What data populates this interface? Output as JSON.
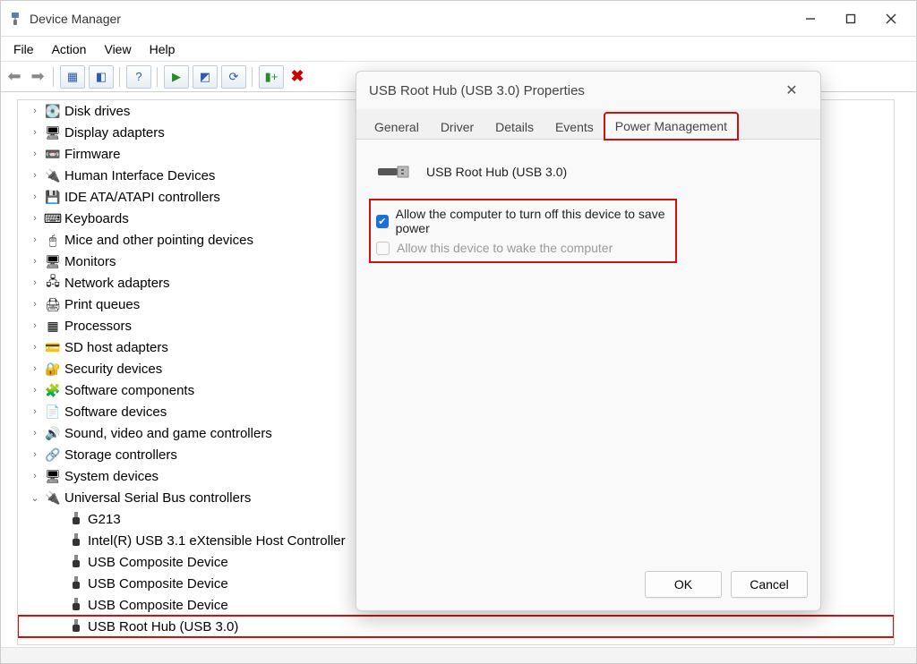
{
  "window": {
    "title": "Device Manager",
    "controls": {
      "minimize": "–",
      "maximize": "▢",
      "close": "✕"
    }
  },
  "menu": {
    "file": "File",
    "action": "Action",
    "view": "View",
    "help": "Help"
  },
  "tree": {
    "items": [
      {
        "icon": "💽",
        "label": "Disk drives"
      },
      {
        "icon": "🖥",
        "label": "Display adapters"
      },
      {
        "icon": "📼",
        "label": "Firmware"
      },
      {
        "icon": "🔌",
        "label": "Human Interface Devices"
      },
      {
        "icon": "💾",
        "label": "IDE ATA/ATAPI controllers"
      },
      {
        "icon": "⌨",
        "label": "Keyboards"
      },
      {
        "icon": "🖱",
        "label": "Mice and other pointing devices"
      },
      {
        "icon": "🖥",
        "label": "Monitors"
      },
      {
        "icon": "🖧",
        "label": "Network adapters"
      },
      {
        "icon": "🖨",
        "label": "Print queues"
      },
      {
        "icon": "▦",
        "label": "Processors"
      },
      {
        "icon": "💳",
        "label": "SD host adapters"
      },
      {
        "icon": "🔐",
        "label": "Security devices"
      },
      {
        "icon": "🧩",
        "label": "Software components"
      },
      {
        "icon": "📄",
        "label": "Software devices"
      },
      {
        "icon": "🔊",
        "label": "Sound, video and game controllers"
      },
      {
        "icon": "🔗",
        "label": "Storage controllers"
      },
      {
        "icon": "🖥",
        "label": "System devices"
      }
    ],
    "usb": {
      "label": "Universal Serial Bus controllers",
      "children": [
        {
          "label": "G213"
        },
        {
          "label": "Intel(R) USB 3.1 eXtensible Host Controller"
        },
        {
          "label": "USB Composite Device"
        },
        {
          "label": "USB Composite Device"
        },
        {
          "label": "USB Composite Device"
        },
        {
          "label": "USB Root Hub (USB 3.0)",
          "highlight": true
        }
      ]
    }
  },
  "dialog": {
    "title": "USB Root Hub (USB 3.0) Properties",
    "tabs": {
      "general": "General",
      "driver": "Driver",
      "details": "Details",
      "events": "Events",
      "power": "Power Management"
    },
    "device_name": "USB Root Hub (USB 3.0)",
    "opt1": "Allow the computer to turn off this device to save power",
    "opt2": "Allow this device to wake the computer",
    "ok": "OK",
    "cancel": "Cancel"
  }
}
